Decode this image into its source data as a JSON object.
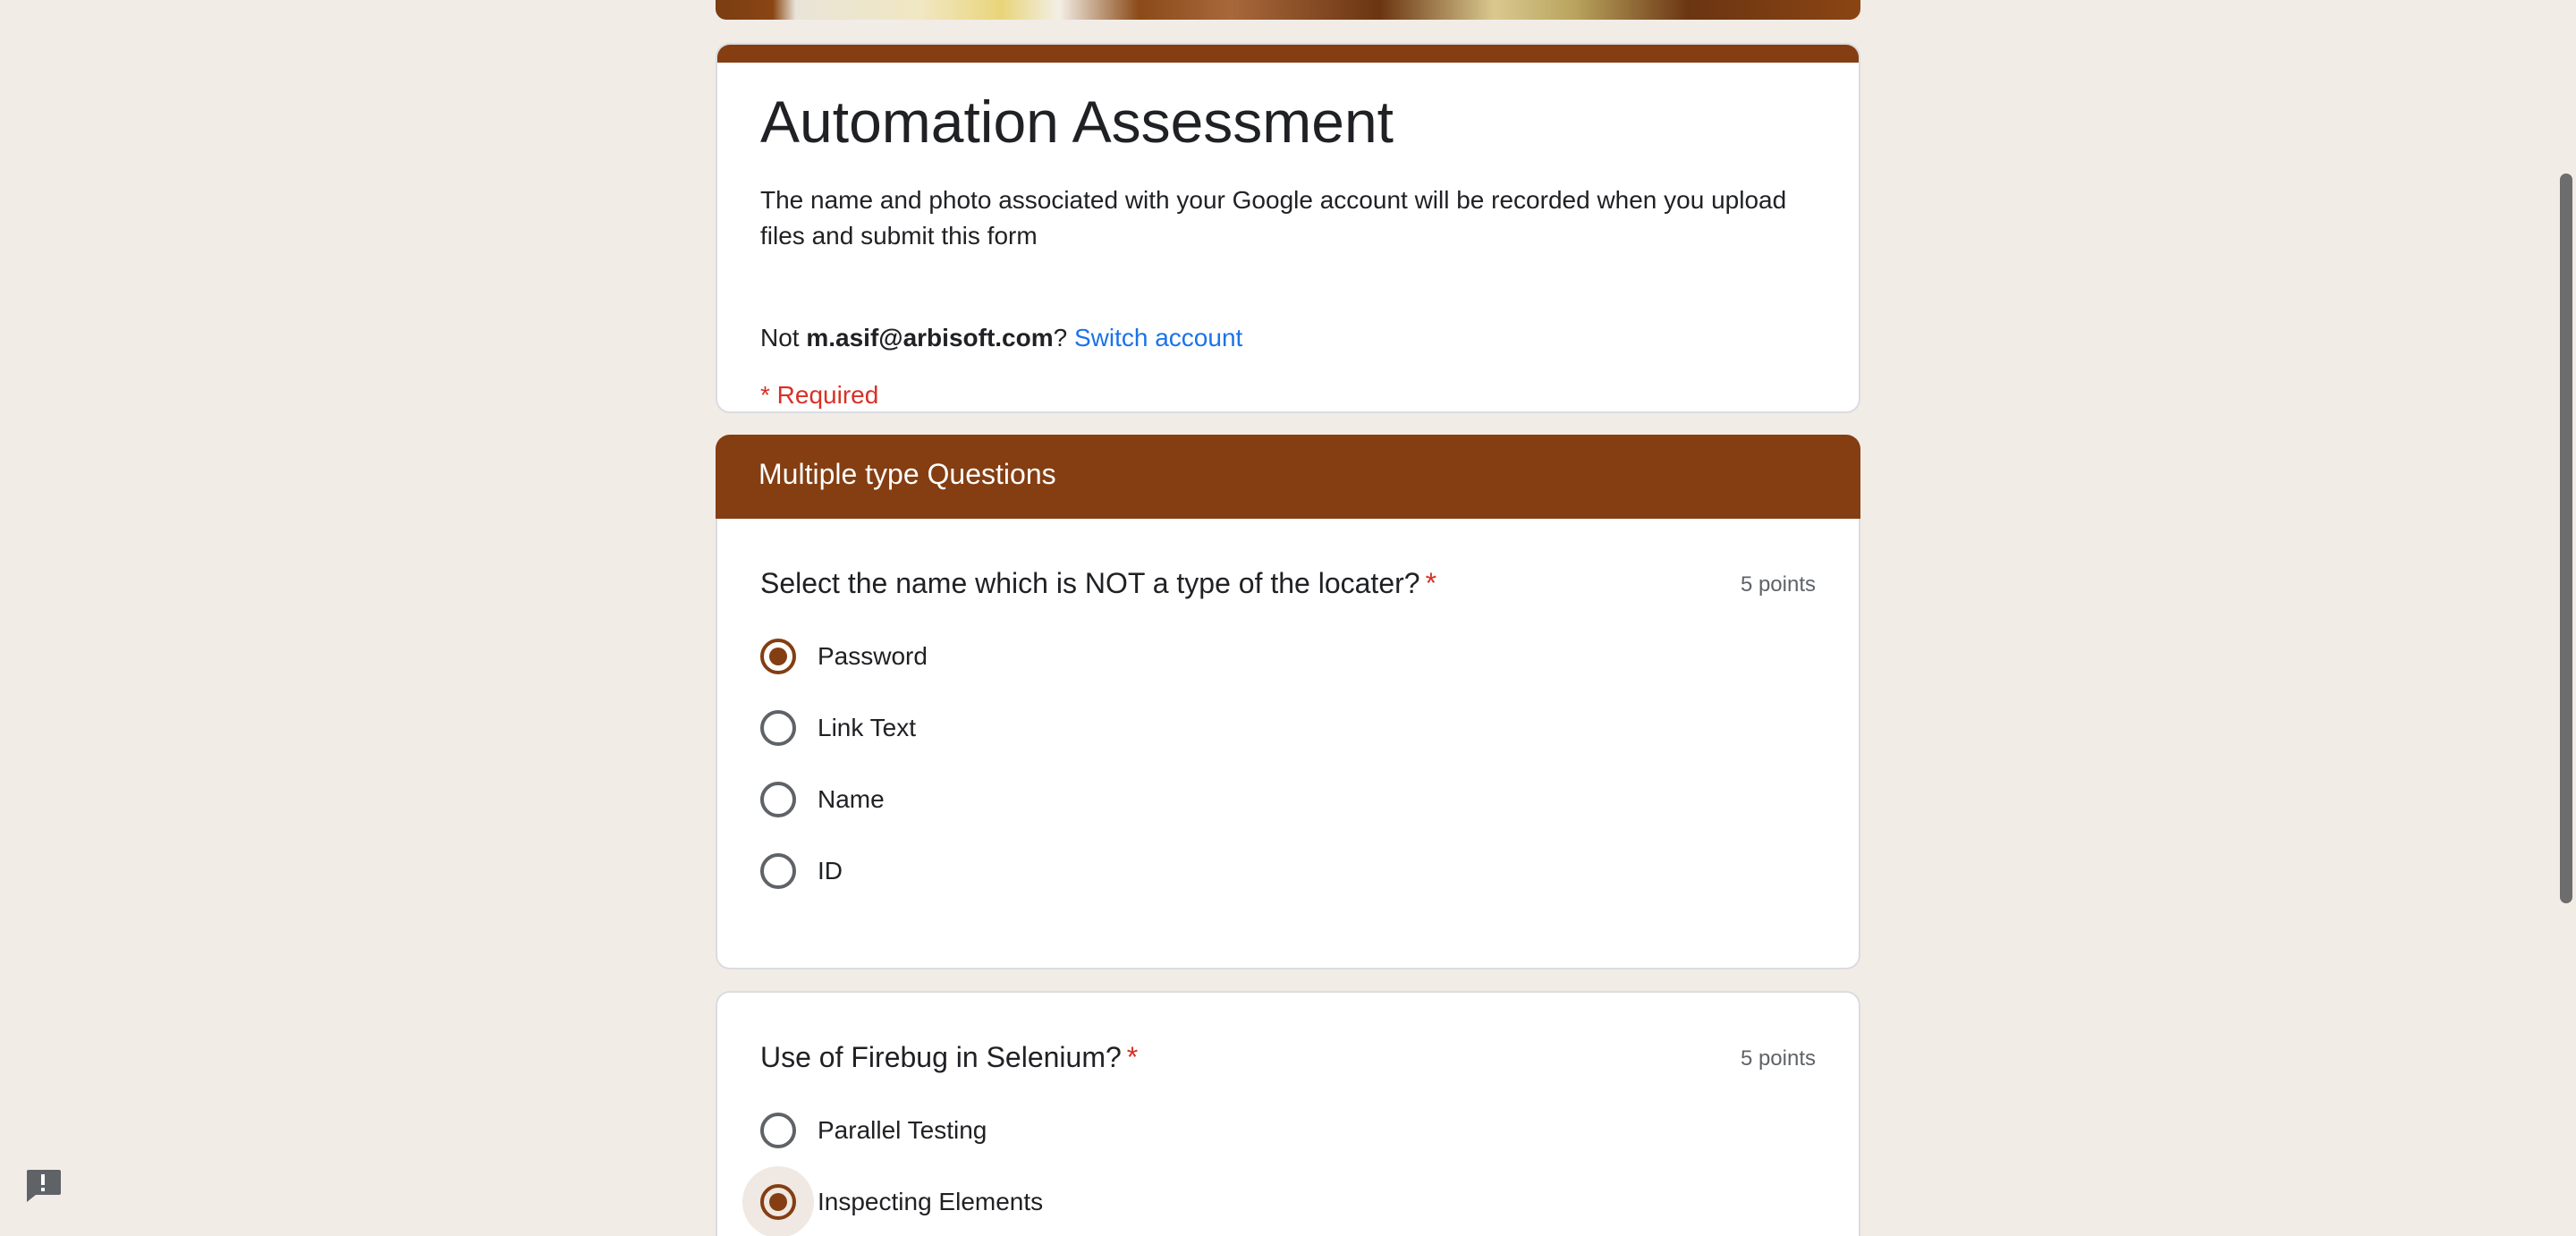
{
  "form": {
    "title": "Automation Assessment",
    "description": "The name and photo associated with your Google account will be recorded when you upload files and submit this form",
    "account_prefix": "Not ",
    "account_email": "m.asif@arbisoft.com",
    "account_suffix": "? ",
    "switch_account": "Switch account",
    "required_note": "* Required"
  },
  "section": {
    "title": "Multiple type Questions"
  },
  "questions": [
    {
      "title": "Select the name which is NOT a type of the locater?",
      "star": "*",
      "points": "5 points",
      "options": [
        "Password",
        "Link Text",
        "Name",
        "ID"
      ],
      "selected": "Password"
    },
    {
      "title": "Use of Firebug in Selenium?",
      "star": "*",
      "points": "5 points",
      "options": [
        "Parallel Testing",
        "Inspecting Elements"
      ],
      "selected": "Inspecting Elements"
    }
  ],
  "colors": {
    "theme": "#843e12",
    "background": "#f2ece6",
    "required": "#d93025",
    "link": "#1a73e8"
  },
  "icons": {
    "feedback": "report-feedback-icon"
  }
}
